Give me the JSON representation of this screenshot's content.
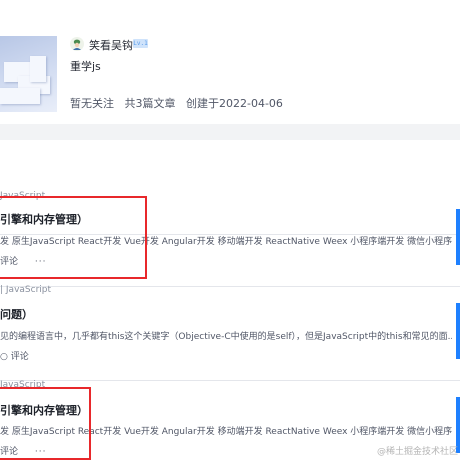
{
  "column": {
    "author_name": "笑看吴钩",
    "level": "Lv.1",
    "title": "重学js",
    "stats": [
      "暂无关注",
      "共3篇文章",
      "创建于2022-04-06"
    ]
  },
  "articles": [
    {
      "tag": "JavaScript",
      "title": "引擎和内存管理）",
      "abstract": "发 原生JavaScript React开发 Vue开发 Angular开发 移动端开发 ReactNative Weex 小程序端开发 微信小程序 ...",
      "comment_label": "评论",
      "more": "···"
    },
    {
      "tag": "JavaScript",
      "title": "问题）",
      "abstract": "见的编程语言中，几乎都有this这个关键字（Objective-C中使用的是self），但是JavaScript中的this和常见的面...",
      "comment_label": "评论",
      "more": "···"
    },
    {
      "tag": "JavaScript",
      "title": "引擎和内存管理）",
      "abstract": "发 原生JavaScript React开发 Vue开发 Angular开发 移动端开发 ReactNative Weex 小程序端开发 微信小程序 ...",
      "comment_label": "评论",
      "more": "···"
    }
  ],
  "watermark": "@稀土掘金技术社区",
  "colors": {
    "accent": "#1e80ff",
    "highlight": "#e8282b",
    "band": "#f2f3f5"
  }
}
